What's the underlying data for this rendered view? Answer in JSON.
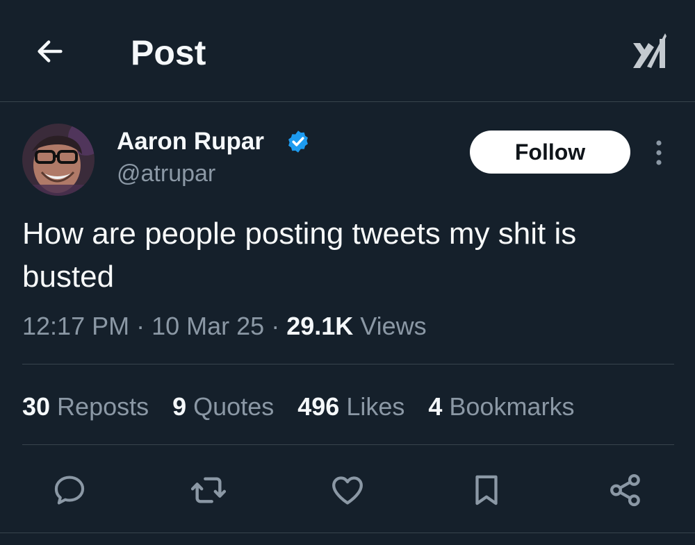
{
  "header": {
    "title": "Post"
  },
  "author": {
    "display_name": "Aaron Rupar",
    "handle": "@atrupar",
    "follow_label": "Follow"
  },
  "tweet": {
    "text": "How are people posting tweets my shit is busted",
    "time": "12:17 PM",
    "date": "10 Mar 25",
    "views_count": "29.1K",
    "views_label": "Views",
    "separator": " · "
  },
  "stats": [
    {
      "count": "30",
      "label": "Reposts"
    },
    {
      "count": "9",
      "label": "Quotes"
    },
    {
      "count": "496",
      "label": "Likes"
    },
    {
      "count": "4",
      "label": "Bookmarks"
    }
  ],
  "actions": [
    {
      "icon": "reply-icon"
    },
    {
      "icon": "repost-icon"
    },
    {
      "icon": "like-icon"
    },
    {
      "icon": "bookmark-icon"
    },
    {
      "icon": "share-icon"
    }
  ],
  "colors": {
    "background": "#15202b",
    "text": "#e7e9ea",
    "secondary_text": "#8b98a5",
    "divider": "#38444d",
    "verified": "#1d9bf0",
    "follow_bg": "#ffffff"
  }
}
